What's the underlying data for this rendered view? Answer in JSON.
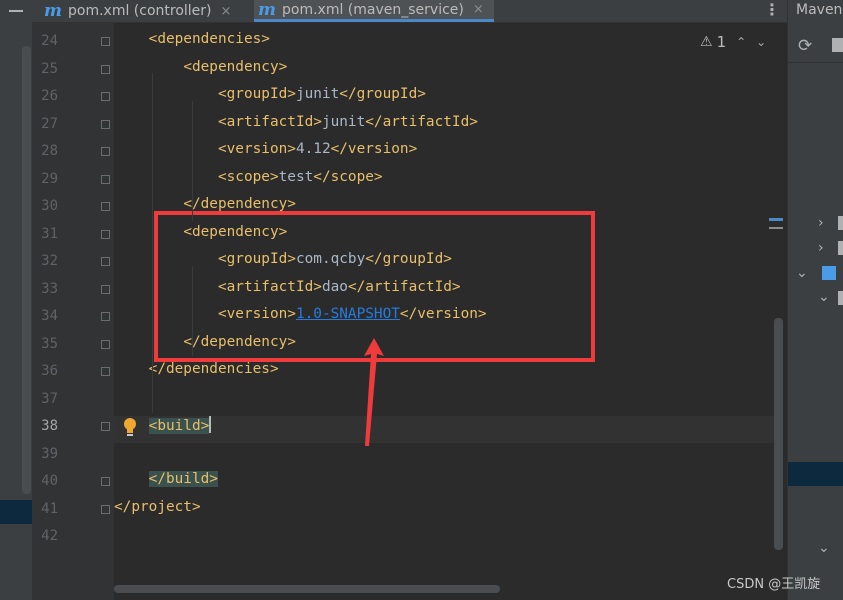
{
  "tabs": [
    {
      "icon_letter": "m",
      "label": "pom.xml (controller)",
      "close": "×",
      "active": false
    },
    {
      "icon_letter": "m",
      "label": "pom.xml (maven_service)",
      "close": "×",
      "active": true
    }
  ],
  "tab_menu": "⋮",
  "right_panel": {
    "title": "Maven"
  },
  "inspection": {
    "warning_icon": "⚠",
    "count": "1",
    "up": "⌃",
    "down": "⌄"
  },
  "editor": {
    "lines": [
      {
        "n": "24",
        "indent": "    ",
        "parts": [
          {
            "t": "<dependencies>",
            "c": "tag"
          }
        ]
      },
      {
        "n": "25",
        "indent": "        ",
        "parts": [
          {
            "t": "<dependency>",
            "c": "tag"
          }
        ]
      },
      {
        "n": "26",
        "indent": "            ",
        "parts": [
          {
            "t": "<groupId>",
            "c": "tag"
          },
          {
            "t": "junit",
            "c": "txt"
          },
          {
            "t": "</groupId>",
            "c": "tag"
          }
        ]
      },
      {
        "n": "27",
        "indent": "            ",
        "parts": [
          {
            "t": "<artifactId>",
            "c": "tag"
          },
          {
            "t": "junit",
            "c": "txt"
          },
          {
            "t": "</artifactId>",
            "c": "tag"
          }
        ]
      },
      {
        "n": "28",
        "indent": "            ",
        "parts": [
          {
            "t": "<version>",
            "c": "tag"
          },
          {
            "t": "4.12",
            "c": "txt"
          },
          {
            "t": "</version>",
            "c": "tag"
          }
        ]
      },
      {
        "n": "29",
        "indent": "            ",
        "parts": [
          {
            "t": "<scope>",
            "c": "tag"
          },
          {
            "t": "test",
            "c": "txt"
          },
          {
            "t": "</scope>",
            "c": "tag"
          }
        ]
      },
      {
        "n": "30",
        "indent": "        ",
        "parts": [
          {
            "t": "</dependency>",
            "c": "tag"
          }
        ]
      },
      {
        "n": "31",
        "indent": "        ",
        "parts": [
          {
            "t": "<dependency>",
            "c": "tag"
          }
        ]
      },
      {
        "n": "32",
        "indent": "            ",
        "parts": [
          {
            "t": "<groupId>",
            "c": "tag"
          },
          {
            "t": "com.qcby",
            "c": "txt"
          },
          {
            "t": "</groupId>",
            "c": "tag"
          }
        ]
      },
      {
        "n": "33",
        "indent": "            ",
        "parts": [
          {
            "t": "<artifactId>",
            "c": "tag"
          },
          {
            "t": "dao",
            "c": "txt"
          },
          {
            "t": "</artifactId>",
            "c": "tag"
          }
        ]
      },
      {
        "n": "34",
        "indent": "            ",
        "parts": [
          {
            "t": "<version>",
            "c": "tag"
          },
          {
            "t": "1.0-SNAPSHOT",
            "c": "link"
          },
          {
            "t": "</version>",
            "c": "tag"
          }
        ]
      },
      {
        "n": "35",
        "indent": "        ",
        "parts": [
          {
            "t": "</dependency>",
            "c": "tag"
          }
        ]
      },
      {
        "n": "36",
        "indent": "    ",
        "parts": [
          {
            "t": "</dependencies>",
            "c": "tag"
          }
        ]
      },
      {
        "n": "37",
        "indent": "",
        "parts": []
      },
      {
        "n": "38",
        "indent": "    ",
        "parts": [
          {
            "t": "<build>",
            "c": "tag hl-tag"
          }
        ],
        "current": true
      },
      {
        "n": "39",
        "indent": "",
        "parts": []
      },
      {
        "n": "40",
        "indent": "    ",
        "parts": [
          {
            "t": "</build>",
            "c": "tag hl-tag"
          }
        ]
      },
      {
        "n": "41",
        "indent": "",
        "parts": [
          {
            "t": "</project>",
            "c": "tag"
          }
        ]
      },
      {
        "n": "42",
        "indent": "",
        "parts": []
      }
    ]
  },
  "watermark": "CSDN @王凯旋",
  "colors": {
    "tag": "#e8bf6a",
    "text": "#a9b7c6",
    "link": "#287bde",
    "annotation_box": "#ef3b3b",
    "tab_accent": "#4a88c7"
  }
}
